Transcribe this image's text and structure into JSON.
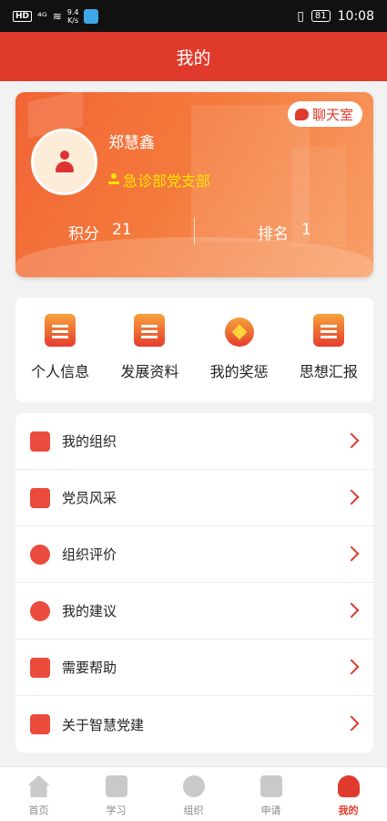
{
  "status_bar": {
    "network": "HD",
    "signal": "⁴ᴳ",
    "speed": "9.4\nK/s",
    "battery": "81",
    "time": "10:08"
  },
  "header": {
    "title": "我的"
  },
  "profile": {
    "name": "郑慧鑫",
    "branch": "急诊部党支部",
    "chat_label": "聊天室",
    "score_label": "积分",
    "score_value": "21",
    "rank_label": "排名",
    "rank_value": "1"
  },
  "quick_actions": [
    {
      "label": "个人信息",
      "icon": "id-card-icon"
    },
    {
      "label": "发展资料",
      "icon": "clipboard-list-icon"
    },
    {
      "label": "我的奖惩",
      "icon": "medal-icon"
    },
    {
      "label": "思想汇报",
      "icon": "report-edit-icon"
    }
  ],
  "menu": [
    {
      "label": "我的组织",
      "icon": "organization-icon"
    },
    {
      "label": "党员风采",
      "icon": "pinwheel-icon"
    },
    {
      "label": "组织评价",
      "icon": "star-badge-icon"
    },
    {
      "label": "我的建议",
      "icon": "comment-icon"
    },
    {
      "label": "需要帮助",
      "icon": "help-icon"
    },
    {
      "label": "关于智慧党建",
      "icon": "about-icon"
    }
  ],
  "tabbar": [
    {
      "label": "首页",
      "icon": "home-icon",
      "active": false
    },
    {
      "label": "学习",
      "icon": "book-icon",
      "active": false
    },
    {
      "label": "组织",
      "icon": "organization-icon",
      "active": false
    },
    {
      "label": "申请",
      "icon": "edit-form-icon",
      "active": false
    },
    {
      "label": "我的",
      "icon": "person-icon",
      "active": true
    }
  ],
  "colors": {
    "accent": "#e03a2c",
    "branch_text": "#ffe400",
    "inactive_tab": "#888888"
  }
}
